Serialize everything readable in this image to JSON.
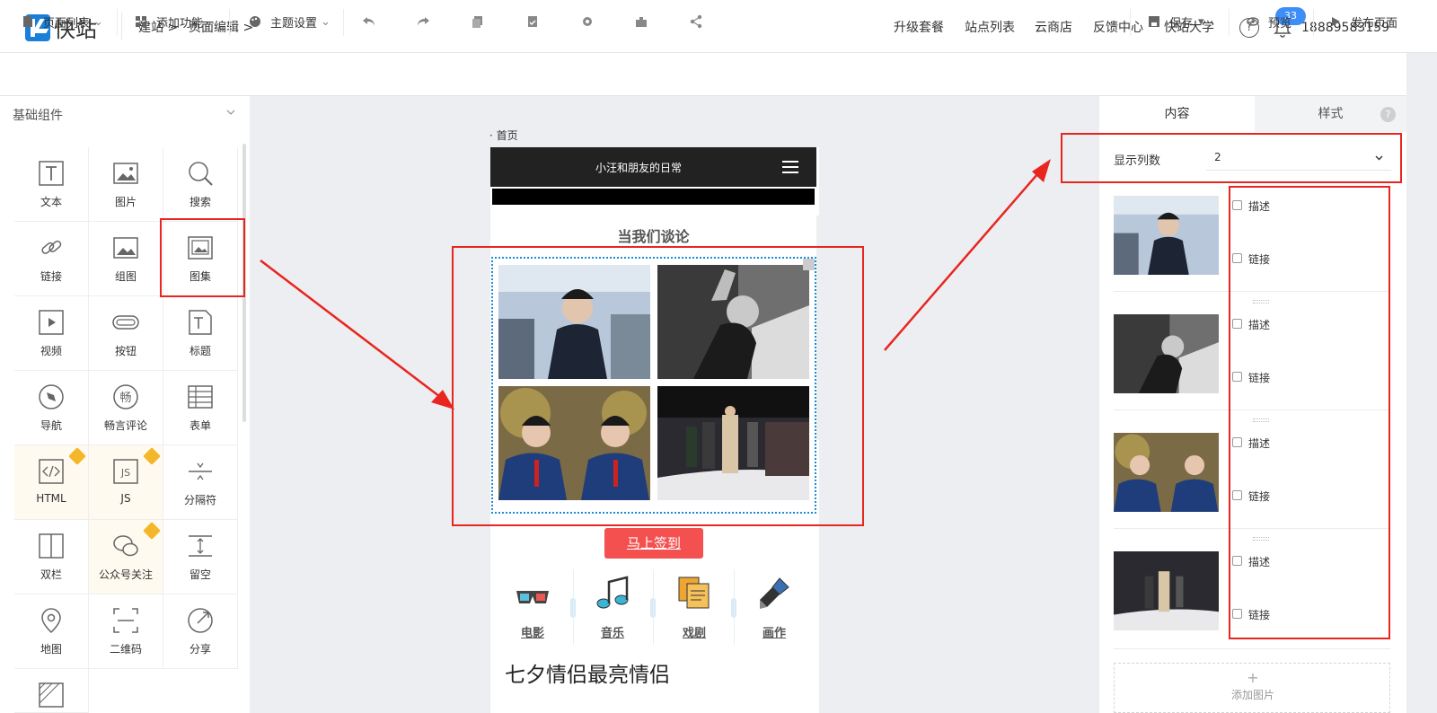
{
  "app": {
    "logo_text": "快站",
    "breadcrumbs": [
      "建站 >",
      "页面编辑 >"
    ]
  },
  "topnav": {
    "items": [
      "升级套餐",
      "站点列表",
      "云商店",
      "反馈中心",
      "快站大学"
    ],
    "help": "?",
    "badge": "33",
    "user": "18889583159"
  },
  "toolbar": {
    "page_list": "页面列表",
    "add_feature": "添加功能",
    "theme": "主题设置",
    "save": "保存",
    "preview": "预览",
    "publish": "发布页面"
  },
  "left": {
    "section_title": "基础组件",
    "items": [
      "文本",
      "图片",
      "搜索",
      "链接",
      "组图",
      "图集",
      "视频",
      "按钮",
      "标题",
      "导航",
      "畅言评论",
      "表单",
      "HTML",
      "JS",
      "分隔符",
      "双栏",
      "公众号关注",
      "留空",
      "地图",
      "二维码",
      "分享"
    ]
  },
  "phone": {
    "page_label": "· 首页",
    "title": "小汪和朋友的日常",
    "subtitle": "当我们谈论",
    "sign_button": "马上签到",
    "categories": [
      "电影",
      "音乐",
      "戏剧",
      "画作"
    ],
    "big_text": "七夕情侣最亮情侣"
  },
  "right": {
    "tabs": [
      "内容",
      "样式"
    ],
    "help": "?",
    "columns_label": "显示列数",
    "columns_value": "2",
    "items": [
      {
        "desc": "描述",
        "link": "链接"
      },
      {
        "desc": "描述",
        "link": "链接"
      },
      {
        "desc": "描述",
        "link": "链接"
      },
      {
        "desc": "描述",
        "link": "链接"
      }
    ],
    "add_plus": "+",
    "add_label": "添加图片"
  },
  "colors": {
    "accent": "#1a7fd9",
    "annotation": "#e8251f",
    "sign": "#f45050"
  }
}
